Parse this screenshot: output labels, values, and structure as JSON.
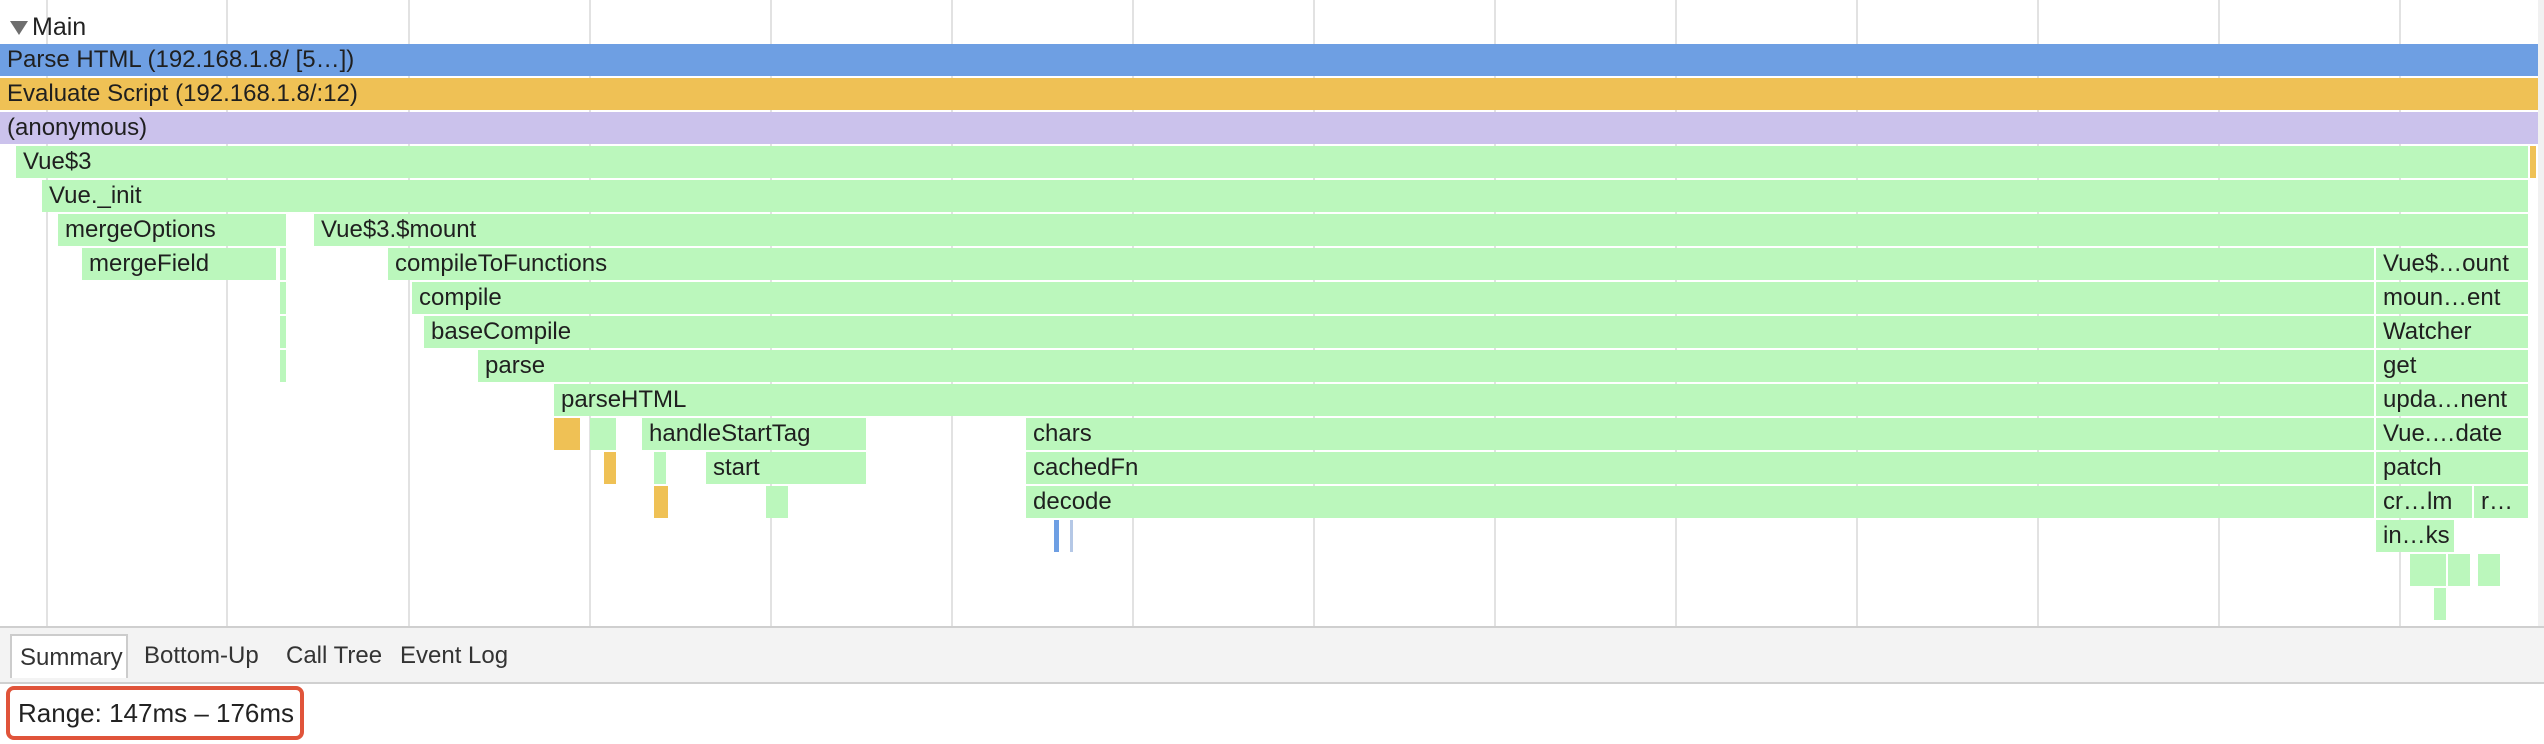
{
  "panel": {
    "title": "Main"
  },
  "flame": {
    "rows": {
      "parse_html": "Parse HTML (192.168.1.8/ [5…])",
      "evaluate_script": "Evaluate Script (192.168.1.8/:12)",
      "anonymous": "(anonymous)",
      "vue3": "Vue$3",
      "vue_init": "Vue._init",
      "merge_options": "mergeOptions",
      "vue3_mount": "Vue$3.$mount",
      "merge_field": "mergeField",
      "compile_to_functions": "compileToFunctions",
      "compile": "compile",
      "base_compile": "baseCompile",
      "parse": "parse",
      "parse_html_fn": "parseHTML",
      "handle_start_tag": "handleStartTag",
      "chars": "chars",
      "start": "start",
      "cached_fn": "cachedFn",
      "decode": "decode"
    },
    "right_column": [
      "Vue$…ount",
      "moun…ent",
      "Watcher",
      "get",
      "upda…nent",
      "Vue.…date",
      "patch",
      "cr…lm",
      "r…",
      "in…ks"
    ]
  },
  "tabs": [
    "Summary",
    "Bottom-Up",
    "Call Tree",
    "Event Log"
  ],
  "summary": {
    "range": "Range: 147ms – 176ms"
  },
  "colors": {
    "parse_html": "#6e9fe3",
    "evaluate_script": "#efc155",
    "anonymous": "#cbc2ec",
    "js_function": "#bbf7bc",
    "highlight_border": "#e0543a"
  }
}
